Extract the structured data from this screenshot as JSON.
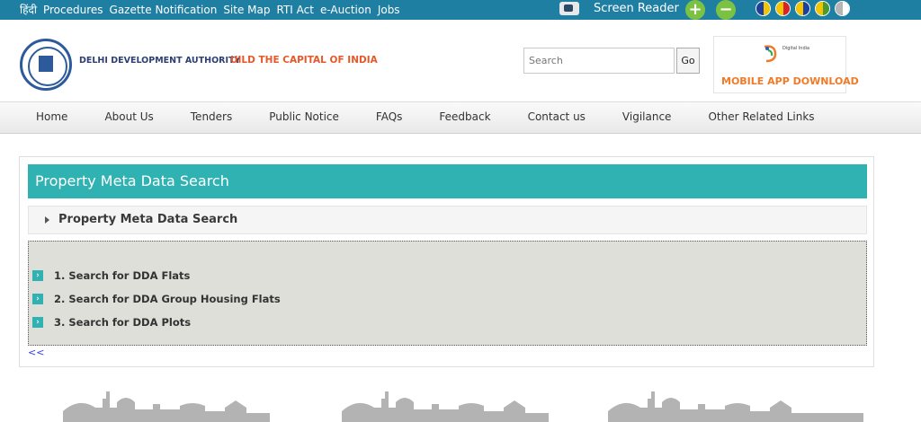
{
  "top_bar": {
    "links": [
      "हिंदी",
      "Procedures",
      "Gazette Notification",
      "Site Map",
      "RTI Act",
      "e-Auction",
      "Jobs"
    ],
    "screen_reader_label": "Screen Reader",
    "increase_font_symbol": "+",
    "decrease_font_symbol": "−",
    "theme_colors": [
      {
        "left": "#1f3f9f",
        "right": "#f4c400"
      },
      {
        "left": "#f4c400",
        "right": "#d8232a"
      },
      {
        "left": "#f4c400",
        "right": "#1f3f9f"
      },
      {
        "left": "#f4c400",
        "right": "#4b9a2f"
      },
      {
        "left": "#b5b5b5",
        "right": "#ffffff"
      }
    ]
  },
  "header": {
    "org_name": "DELHI DEVELOPMENT AUTHORITY",
    "tagline": "UILD THE CAPITAL OF INDIA",
    "search_placeholder": "Search",
    "search_button": "Go",
    "app_banner_small_text": "Digital India",
    "app_banner_label": "MOBILE APP DOWNLOAD"
  },
  "main_nav": {
    "items": [
      "Home",
      "About Us",
      "Tenders",
      "Public Notice",
      "FAQs",
      "Feedback",
      "Contact us",
      "Vigilance",
      "Other Related Links"
    ]
  },
  "content": {
    "panel_title": "Property Meta Data Search",
    "accordion_title": "Property Meta Data Search",
    "links": [
      "1. Search for DDA Flats",
      "2. Search for DDA Group Housing Flats",
      "3. Search for DDA Plots"
    ],
    "back_label": "<<"
  },
  "colors": {
    "top_bar_bg": "#1f7fa3",
    "accent_teal": "#2fb2b1",
    "tagline_orange": "#e8572a",
    "app_label_orange": "#f07a28"
  }
}
